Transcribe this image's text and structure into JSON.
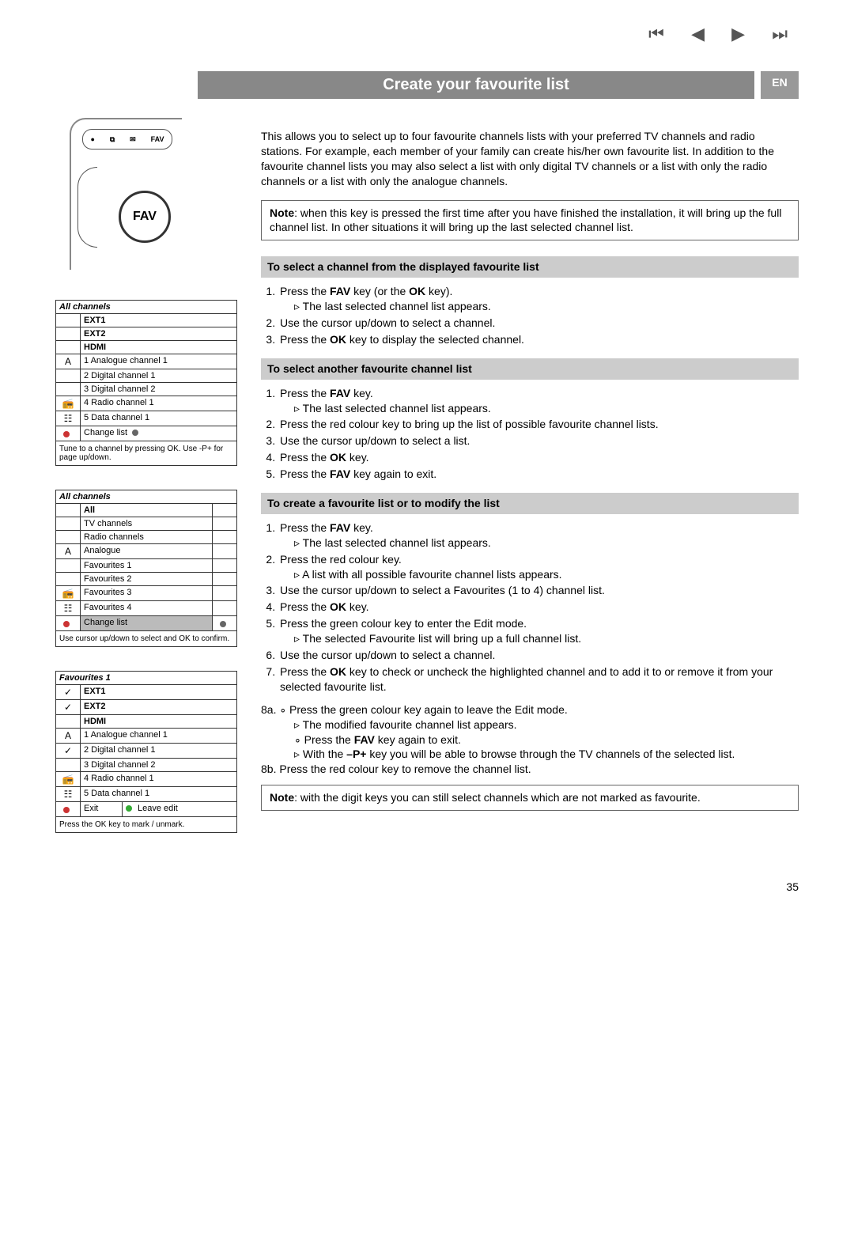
{
  "lang": "EN",
  "page_number": "35",
  "nav_icons": {
    "first": "⏮",
    "prev": "◀",
    "play": "▶",
    "next": "⏭"
  },
  "title": "Create your favourite list",
  "intro": "This allows you to select up to four favourite channels lists with your preferred TV channels and radio stations. For example, each member of your family can create his/her own favourite list. In addition to the favourite channel lists you may also select a list with only digital TV channels or a list with only the radio channels or a list with only the analogue channels.",
  "note1_prefix": "Note",
  "note1": ": when this key is pressed the first time after you have finished the installation, it will bring up the full channel list. In other situations it will bring up the last selected channel list.",
  "note2_prefix": "Note",
  "note2": ": with the digit keys you can still select channels which are not marked as favourite.",
  "remote": {
    "row": [
      "●",
      "⧉",
      "✉",
      "FAV"
    ],
    "fav_label": "FAV"
  },
  "osd1": {
    "hdr": "All channels",
    "fixed": [
      "EXT1",
      "EXT2",
      "HDMI"
    ],
    "rows": [
      {
        "icon": "A",
        "text": "1 Analogue channel 1"
      },
      {
        "icon": "",
        "text": "2 Digital channel 1"
      },
      {
        "icon": "",
        "text": "3 Digital channel 2"
      },
      {
        "icon": "📻",
        "text": "4 Radio channel 1"
      },
      {
        "icon": "☷",
        "text": "5 Data channel 1"
      }
    ],
    "action": "Change list",
    "foot": "Tune to a channel by pressing OK. Use -P+ for page up/down."
  },
  "osd2": {
    "hdr": "All channels",
    "rows": [
      "All",
      "TV channels",
      "Radio channels",
      "Analogue",
      "Favourites 1",
      "Favourites 2",
      "Favourites 3",
      "Favourites 4"
    ],
    "icons": [
      "",
      "",
      "",
      "A",
      "",
      "",
      "📻",
      "☷"
    ],
    "action": "Change list",
    "foot": "Use cursor up/down to select and OK to confirm."
  },
  "osd3": {
    "hdr": "Favourites 1",
    "fixed": [
      "EXT1",
      "EXT2",
      "HDMI"
    ],
    "rows": [
      {
        "icon": "A",
        "text": "1 Analogue channel 1"
      },
      {
        "icon": "",
        "text": "2 Digital channel 1"
      },
      {
        "icon": "",
        "text": "3 Digital channel 2"
      },
      {
        "icon": "📻",
        "text": "4 Radio channel 1"
      },
      {
        "icon": "☷",
        "text": "5 Data channel 1"
      }
    ],
    "exit": "Exit",
    "leave": "Leave edit",
    "foot": "Press the OK key to mark / unmark."
  },
  "sec1_hdr": "To select a channel from the displayed favourite list",
  "sec1_1a": "Press the ",
  "sec1_1b": "FAV",
  "sec1_1c": " key (or the ",
  "sec1_1d": "OK",
  "sec1_1e": " key).",
  "sec1_1sub": "The last selected channel list appears.",
  "sec1_2": "Use the cursor up/down to select a channel.",
  "sec1_3a": "Press the ",
  "sec1_3b": "OK",
  "sec1_3c": " key to display the selected channel.",
  "sec2_hdr": "To select another favourite channel list",
  "sec2_1a": "Press the ",
  "sec2_1b": "FAV",
  "sec2_1c": " key.",
  "sec2_1sub": "The last selected channel list appears.",
  "sec2_2": "Press the red colour key to bring up the list of possible favourite channel lists.",
  "sec2_3": "Use the cursor up/down to select a list.",
  "sec2_4a": "Press the ",
  "sec2_4b": "OK",
  "sec2_4c": " key.",
  "sec2_5a": "Press the ",
  "sec2_5b": "FAV",
  "sec2_5c": " key again to exit.",
  "sec3_hdr": "To create a favourite list or to modify the list",
  "sec3_1a": "Press the ",
  "sec3_1b": "FAV",
  "sec3_1c": " key.",
  "sec3_1sub": "The last selected channel list appears.",
  "sec3_2": "Press the red colour key.",
  "sec3_2sub": "A list with all possible favourite channel lists appears.",
  "sec3_3": "Use the cursor up/down to select a Favourites (1 to 4) channel list.",
  "sec3_4a": "Press the ",
  "sec3_4b": "OK",
  "sec3_4c": " key.",
  "sec3_5": "Press the green colour key to enter the Edit mode.",
  "sec3_5sub": "The selected Favourite list will bring up a full channel list.",
  "sec3_6": "Use the cursor up/down to select a channel.",
  "sec3_7a": "Press the ",
  "sec3_7b": "OK",
  "sec3_7c": " key to check or uncheck the highlighted channel and to add it to or remove it from your selected favourite list.",
  "sec3_8a": "8a. ∘ Press the green colour key again to leave the Edit mode.",
  "sec3_8a_sub1": "The modified favourite channel list appears.",
  "sec3_8a_sub2a": "Press the ",
  "sec3_8a_sub2b": "FAV",
  "sec3_8a_sub2c": " key again to exit.",
  "sec3_8a_sub3a": "With the ",
  "sec3_8a_sub3b": "–P+",
  "sec3_8a_sub3c": " key you will be able to browse through the TV channels of the selected list.",
  "sec3_8b": "8b. Press the red colour key to remove the channel list."
}
